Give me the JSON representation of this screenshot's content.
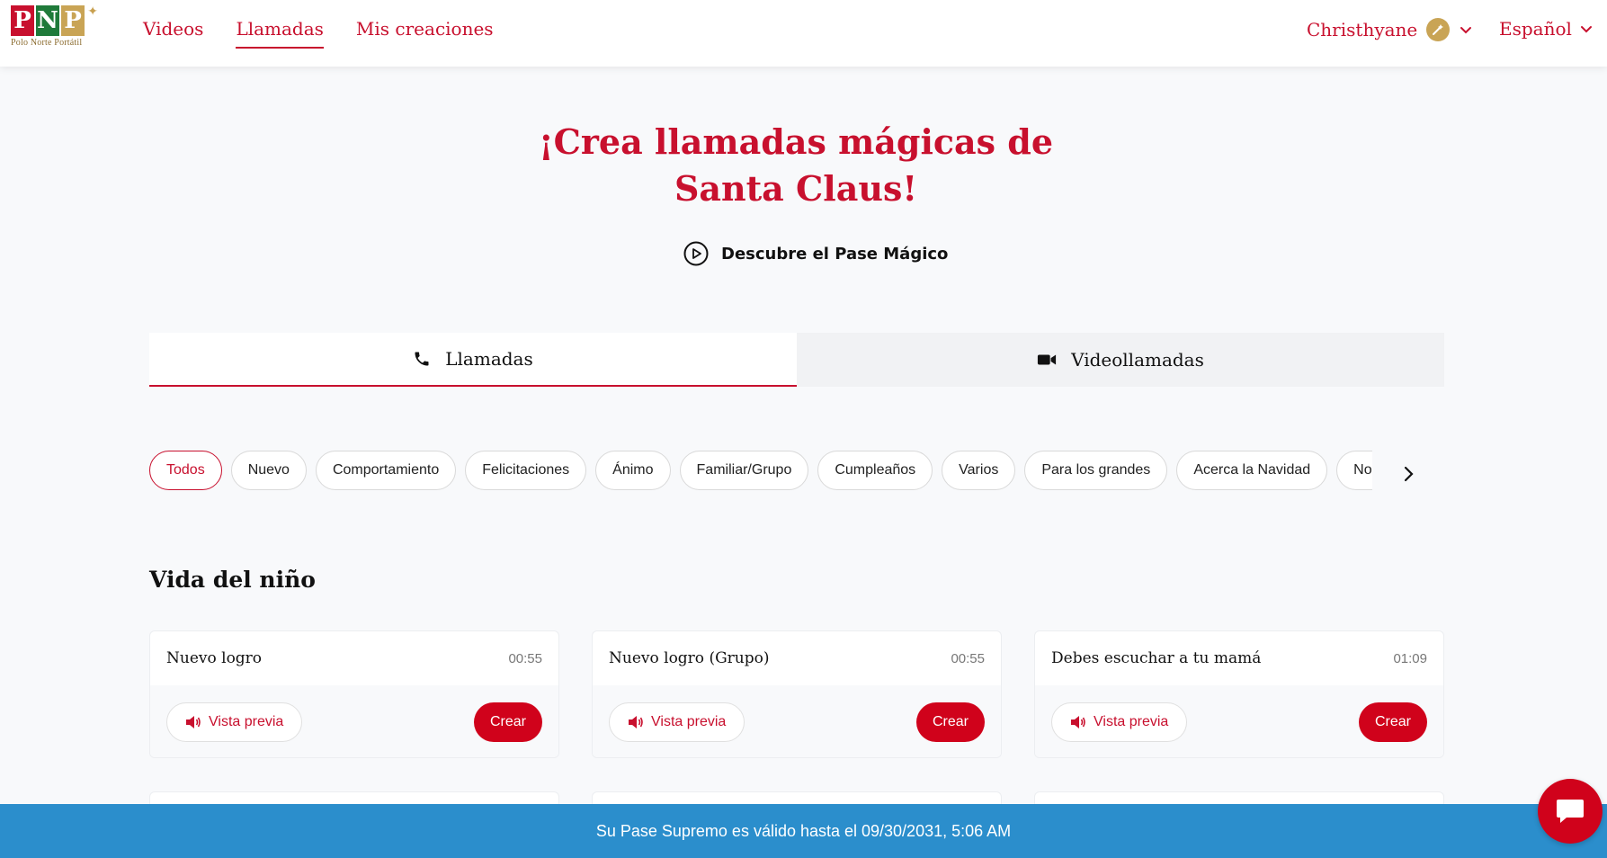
{
  "brand": {
    "logo_letters": [
      "P",
      "N",
      "P"
    ],
    "logo_colors": [
      "#c8102e",
      "#1f7a3a",
      "#c9a455"
    ],
    "logo_subtitle": "Polo Norte Portátil"
  },
  "nav": {
    "items": [
      {
        "label": "Videos",
        "active": false
      },
      {
        "label": "Llamadas",
        "active": true
      },
      {
        "label": "Mis creaciones",
        "active": false
      }
    ]
  },
  "user": {
    "name": "Christhyane",
    "badge_icon": "magic-pass-badge-icon"
  },
  "language": {
    "selected": "Español"
  },
  "hero": {
    "title": "¡Crea llamadas mágicas de Santa Claus!",
    "discover_label": "Descubre el Pase Mágico"
  },
  "tabs": [
    {
      "label": "Llamadas",
      "icon": "phone-icon",
      "active": true
    },
    {
      "label": "Videollamadas",
      "icon": "video-camera-icon",
      "active": false
    }
  ],
  "categories": [
    "Todos",
    "Nuevo",
    "Comportamiento",
    "Felicitaciones",
    "Ánimo",
    "Familiar/Grupo",
    "Cumpleaños",
    "Varios",
    "Para los grandes",
    "Acerca la Navidad",
    "Noch"
  ],
  "active_category": "Todos",
  "section": {
    "title": "Vida del niño",
    "cards": [
      {
        "name": "Nuevo logro",
        "duration": "00:55",
        "preview_label": "Vista previa",
        "create_label": "Crear"
      },
      {
        "name": "Nuevo logro (Grupo)",
        "duration": "00:55",
        "preview_label": "Vista previa",
        "create_label": "Crear"
      },
      {
        "name": "Debes escuchar a tu mamá",
        "duration": "01:09",
        "preview_label": "Vista previa",
        "create_label": "Crear"
      }
    ]
  },
  "footer_bar": {
    "text": "Su Pase Supremo es válido hasta el 09/30/2031, 5:06 AM"
  },
  "colors": {
    "accent": "#c8102e",
    "button_red": "#d0021b",
    "banner_blue": "#2b8ecc",
    "gold": "#c9a455"
  }
}
